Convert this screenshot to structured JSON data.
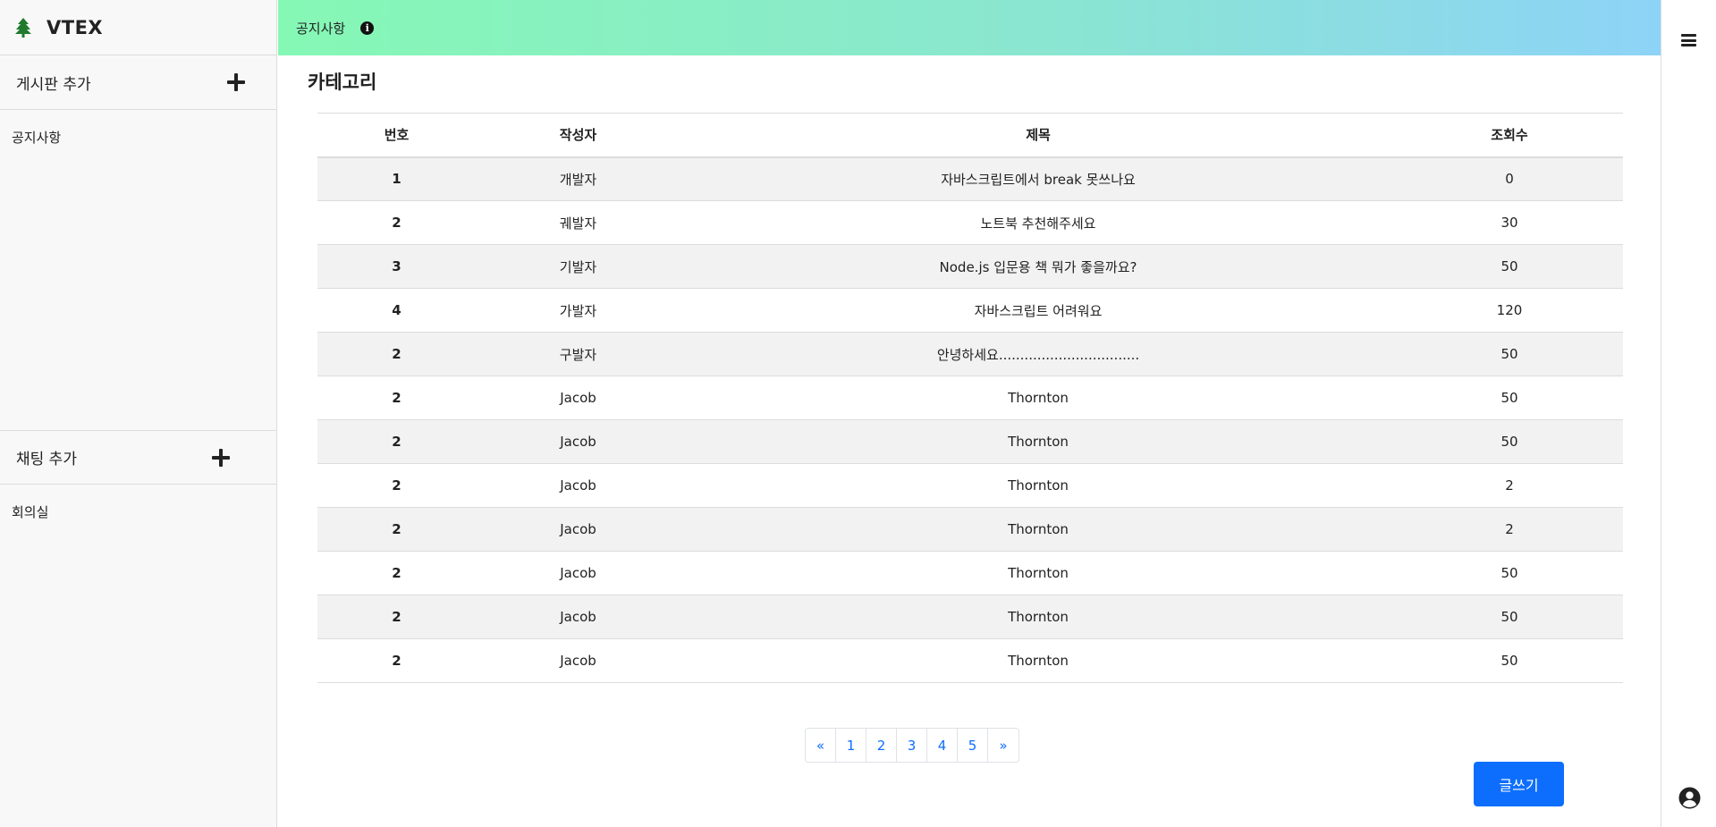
{
  "app": {
    "name": "VTEX"
  },
  "sidebar": {
    "board_section": {
      "label": "게시판 추가",
      "items": [
        {
          "label": "공지사항"
        }
      ]
    },
    "chat_section": {
      "label": "채팅 추가",
      "items": [
        {
          "label": "회의실"
        }
      ]
    }
  },
  "header": {
    "title": "공지사항"
  },
  "main": {
    "category": "카테고리",
    "table": {
      "columns": [
        "번호",
        "작성자",
        "제목",
        "조회수"
      ],
      "rows": [
        [
          "1",
          "개발자",
          "자바스크립트에서 break 못쓰나요",
          "0"
        ],
        [
          "2",
          "궤발자",
          "노트북 추천해주세요",
          "30"
        ],
        [
          "3",
          "기발자",
          "Node.js 입문용 책 뭐가 좋을까요?",
          "50"
        ],
        [
          "4",
          "가발자",
          "자바스크립트 어려워요",
          "120"
        ],
        [
          "2",
          "구발자",
          "안녕하세요.................................",
          "50"
        ],
        [
          "2",
          "Jacob",
          "Thornton",
          "50"
        ],
        [
          "2",
          "Jacob",
          "Thornton",
          "50"
        ],
        [
          "2",
          "Jacob",
          "Thornton",
          "2"
        ],
        [
          "2",
          "Jacob",
          "Thornton",
          "2"
        ],
        [
          "2",
          "Jacob",
          "Thornton",
          "50"
        ],
        [
          "2",
          "Jacob",
          "Thornton",
          "50"
        ],
        [
          "2",
          "Jacob",
          "Thornton",
          "50"
        ]
      ]
    },
    "pagination": [
      "«",
      "1",
      "2",
      "3",
      "4",
      "5",
      "»"
    ],
    "write_button": "글쓰기"
  },
  "colors": {
    "accent": "#0d6efd",
    "header_gradient_start": "#86f8b5",
    "header_gradient_end": "#8dd3f7"
  }
}
